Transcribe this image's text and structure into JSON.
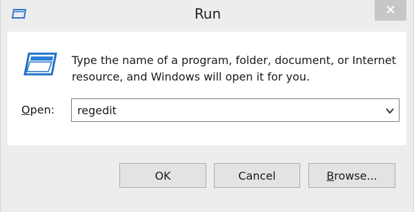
{
  "window": {
    "title": "Run",
    "title_icon": "run-dialog-icon",
    "close_icon": "close-icon"
  },
  "dialog": {
    "description": "Type the name of a program, folder, document, or Internet resource, and Windows will open it for you.",
    "app_icon": "run-program-icon"
  },
  "open_field": {
    "label_hotkey": "O",
    "label_rest": "pen:",
    "value": "regedit",
    "dropdown_icon": "chevron-down-icon"
  },
  "buttons": {
    "ok": "OK",
    "cancel": "Cancel",
    "browse_hotkey": "B",
    "browse_rest": "rowse..."
  },
  "colors": {
    "window_bg": "#ededed",
    "content_bg": "#ffffff",
    "accent_blue": "#1e6fc4"
  }
}
